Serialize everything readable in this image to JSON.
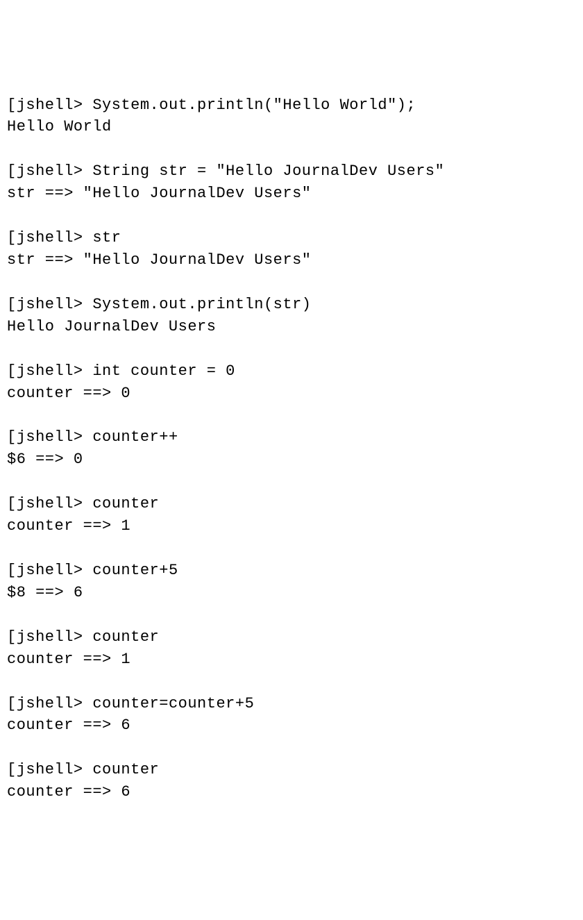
{
  "prompt_bracket": "[",
  "prompt_text": "jshell> ",
  "blocks": [
    {
      "input": "System.out.println(\"Hello World\");",
      "output": "Hello World"
    },
    {
      "input": "String str = \"Hello JournalDev Users\"",
      "output": "str ==> \"Hello JournalDev Users\""
    },
    {
      "input": "str",
      "output": "str ==> \"Hello JournalDev Users\""
    },
    {
      "input": "System.out.println(str)",
      "output": "Hello JournalDev Users"
    },
    {
      "input": "int counter = 0",
      "output": "counter ==> 0"
    },
    {
      "input": "counter++",
      "output": "$6 ==> 0"
    },
    {
      "input": "counter",
      "output": "counter ==> 1"
    },
    {
      "input": "counter+5",
      "output": "$8 ==> 6"
    },
    {
      "input": "counter",
      "output": "counter ==> 1"
    },
    {
      "input": "counter=counter+5",
      "output": "counter ==> 6"
    },
    {
      "input": "counter",
      "output": "counter ==> 6"
    }
  ]
}
